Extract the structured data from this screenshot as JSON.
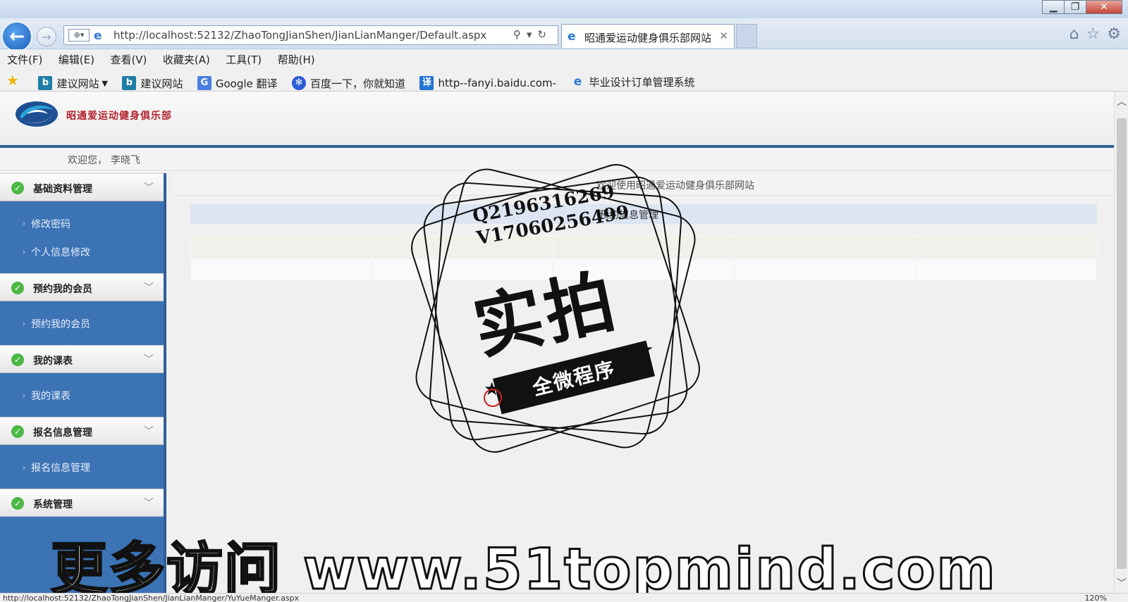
{
  "browser": {
    "address_url": "http://localhost:52132/ZhaoTongJianShen/JianLianManger/Default.aspx",
    "tab_title": "昭通爱运动健身俱乐部网站",
    "menu": [
      "文件(F)",
      "编辑(E)",
      "查看(V)",
      "收藏夹(A)",
      "工具(T)",
      "帮助(H)"
    ],
    "favorites": [
      {
        "icon": "bing",
        "label": "建议网站",
        "dropdown": true
      },
      {
        "icon": "bing",
        "label": "建议网站"
      },
      {
        "icon": "google-translate",
        "label": "Google 翻译"
      },
      {
        "icon": "baidu",
        "label": "百度一下，你就知道"
      },
      {
        "icon": "translate",
        "label": "http--fanyi.baidu.com-"
      },
      {
        "icon": "ie",
        "label": "毕业设计订单管理系统"
      }
    ],
    "status_url": "http://localhost:52132/ZhaoTongJianShen/JianLianManger/YuYueManger.aspx",
    "zoom": "120%"
  },
  "site": {
    "name": "昭通爱运动健身俱乐部",
    "welcome_prefix": "欢迎您，",
    "user_name": "李晓飞",
    "main_title": "欢迎使用昭通爱运动健身俱乐部网站",
    "panel_title": "预约信息管理"
  },
  "sidebar": {
    "groups": [
      {
        "title": "基础资料管理",
        "items": [
          "修改密码",
          "个人信息修改"
        ]
      },
      {
        "title": "预约我的会员",
        "items": [
          "预约我的会员"
        ]
      },
      {
        "title": "我的课表",
        "items": [
          "我的课表"
        ]
      },
      {
        "title": "报名信息管理",
        "items": [
          "报名信息管理"
        ]
      },
      {
        "title": "系统管理",
        "items": []
      }
    ]
  },
  "watermark": {
    "qq": "Q2196316269",
    "vx": "V17060256499",
    "big": "实拍",
    "ribbon": "全微程序",
    "promo": "更多访问 www.51topmind.com"
  },
  "colors": {
    "sidebar_bg": "#3b73b5",
    "header_line": "#2f5f95",
    "site_name": "#b2232d"
  }
}
